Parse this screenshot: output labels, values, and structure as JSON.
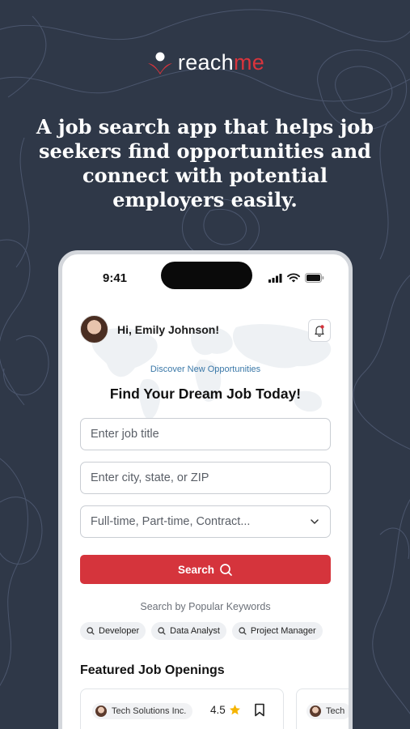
{
  "brand": {
    "name_prefix": "reach",
    "name_accent": "me",
    "accent_color": "#d5343c",
    "background_color": "#2f3848",
    "logo_icon": "person-swoosh-icon"
  },
  "headline": "A job search app that helps job seekers find opportunities and connect with potential employers easily.",
  "phone": {
    "status_bar": {
      "time": "9:41",
      "icons": [
        "signal-icon",
        "wifi-icon",
        "battery-icon"
      ]
    },
    "header": {
      "greeting": "Hi, Emily Johnson!",
      "notification_icon": "bell-icon"
    },
    "hero": {
      "eyebrow": "Discover New Opportunities",
      "title": "Find Your Dream Job Today!"
    },
    "search_form": {
      "job_title_placeholder": "Enter job title",
      "location_placeholder": "Enter city, state, or ZIP",
      "job_type_value": "Full-time, Part-time, Contract...",
      "search_label": "Search"
    },
    "popular": {
      "label": "Search by Popular Keywords",
      "keywords": [
        "Developer",
        "Data Analyst",
        "Project Manager"
      ]
    },
    "featured": {
      "title": "Featured Job Openings",
      "cards": [
        {
          "company": "Tech Solutions Inc.",
          "rating": "4.5"
        },
        {
          "company": "Tech"
        }
      ]
    }
  }
}
